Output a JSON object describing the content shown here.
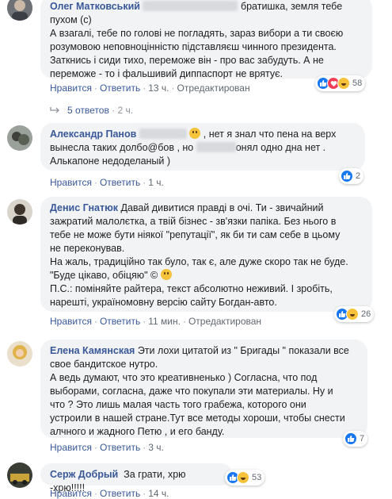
{
  "comments": [
    {
      "author": "Олег Матковський",
      "text_lines": [
        "братишка, земля тебе",
        "пухом (с)",
        "А взагалі, тебе по голові не погладять, зараз вибори а ти своєю",
        "розумовою неповноцінністю підставляєш чинного президента.",
        "Заткнись і сиди тихо, переможе він - про вас забудуть. А не",
        "переможе - то і фальшивий диппаспорт не врятує."
      ],
      "actions": {
        "like": "Нравится",
        "reply": "Ответить",
        "time": "13 ч.",
        "edited": "Отредактирован"
      },
      "reaction_count": "58",
      "reactions": [
        "like",
        "love",
        "haha"
      ],
      "replies": {
        "label": "5 ответов",
        "time": "2 ч."
      }
    },
    {
      "author": "Александр Панов",
      "text_lines": [
        ", нет я знал что пена на верх",
        "вынесла таких долбо@бов , но",
        "онял одно дна нет .",
        "Алькапоне недоделаный )"
      ],
      "actions": {
        "like": "Нравится",
        "reply": "Ответить",
        "time": "1 ч."
      },
      "reaction_count": "2",
      "reactions": [
        "like"
      ]
    },
    {
      "author": "Денис Гнатюк",
      "text_lines": [
        "Давай дивитися правді в очі. Ти - звичайний",
        "зажратий малолєтка, а твій бізнес - зв'язки папіка. Без нього в",
        "тебе не може бути ніякої \"репутації\", як би ти сам себе в цьому",
        "не переконував.",
        "На жаль, традиційно так було, так є, але дуже скоро так не буде.",
        "\"Буде цікаво, обіцяю\" ©",
        "П.С.: поміняйте райтера, текст абсолютно неживий. І зробіть,",
        "нарешті, україномовну версію сайту Богдан-авто."
      ],
      "actions": {
        "like": "Нравится",
        "reply": "Ответить",
        "time": "11 мин.",
        "edited": "Отредактирован"
      },
      "reaction_count": "26",
      "reactions": [
        "like",
        "haha"
      ]
    },
    {
      "author": "Елена Камянская",
      "text_lines": [
        "Эти лохи цитатой из \" Бригады \" показали все",
        "свое бандитское нутро.",
        "А ведь думают, что это креативненько ) Согласна, что под",
        "выборами, согласна, даже что покупали эти материалы. Ну и",
        "что ? Это лишь малая часть того грабежа, которого они",
        "устроили в нашей стране.Тут все методы хороши, чтобы снести",
        "алчного и жадного Петю , и его банду."
      ],
      "actions": {
        "like": "Нравится",
        "reply": "Ответить",
        "time": "3 ч."
      },
      "reaction_count": "7",
      "reactions": [
        "like"
      ]
    },
    {
      "author": "Серж Добрый",
      "text_lines": [
        "За грати, хрю -хрю!!!!!"
      ],
      "actions": {
        "like": "Нравится",
        "reply": "Ответить",
        "time": "14 ч."
      },
      "reaction_count": "53",
      "reactions": [
        "like",
        "haha"
      ]
    }
  ],
  "colors": {
    "link": "#385898",
    "bubble": "#f2f3f5",
    "like": "#1877f2",
    "love": "#f33e58",
    "haha": "#f7c23a"
  }
}
